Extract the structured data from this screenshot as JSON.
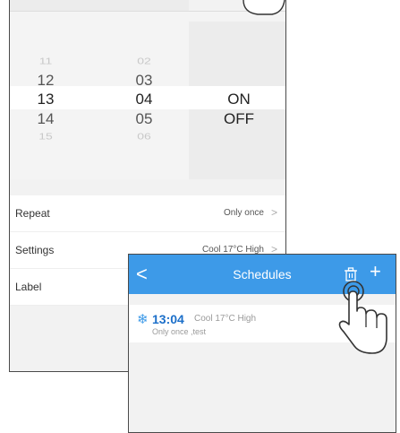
{
  "picker": {
    "hours": [
      "11",
      "12",
      "13",
      "14",
      "15"
    ],
    "minutes": [
      "02",
      "03",
      "04",
      "05",
      "06"
    ],
    "mode_on": "ON",
    "mode_off": "OFF"
  },
  "settings": {
    "items": [
      {
        "label": "Repeat",
        "value": "Only once",
        "chevron": ">"
      },
      {
        "label": "Settings",
        "value": "Cool 17°C High",
        "chevron": ">"
      },
      {
        "label": "Label",
        "value": "",
        "chevron": ""
      }
    ]
  },
  "schedules": {
    "title": "Schedules",
    "back_glyph": "<",
    "add_glyph": "+",
    "item": {
      "time": "13:04",
      "mode": "Cool 17°C High",
      "note": "Only once ,test"
    }
  },
  "colors": {
    "accent": "#3d9ae8",
    "time_text": "#1c6fc9"
  },
  "icons": {
    "back": "chevron-left-icon",
    "delete": "trash-icon",
    "add": "plus-icon",
    "snow": "snowflake-icon",
    "cursor": "hand-pointer-icon"
  }
}
